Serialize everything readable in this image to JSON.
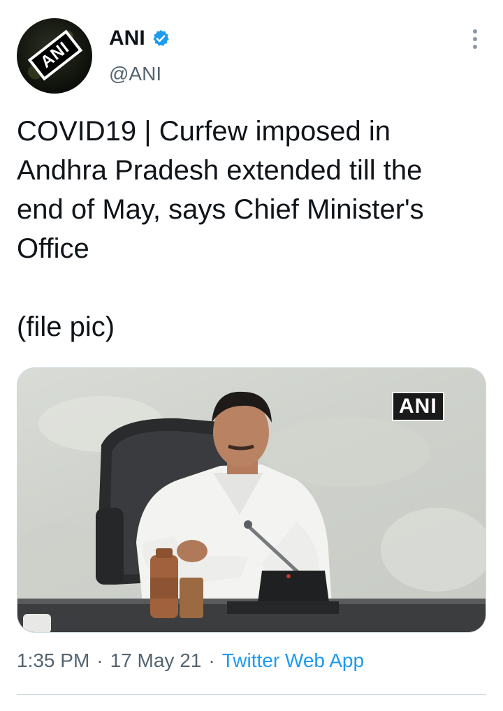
{
  "author": {
    "name": "ANI",
    "handle": "@ANI",
    "avatar_text": "ANI",
    "verified": true,
    "verified_icon": "verified-badge-icon"
  },
  "tweet": {
    "text": "COVID19 | Curfew imposed in\nAndhra Pradesh extended till the\nend of May, says Chief Minister's\nOffice\n\n(file pic)",
    "media": {
      "watermark": "ANI"
    }
  },
  "meta": {
    "time": "1:35 PM",
    "separator": "·",
    "date": "17 May 21",
    "source": "Twitter Web App"
  },
  "colors": {
    "accent": "#1d9bf0",
    "secondary_text": "#536471",
    "primary_text": "#0f1419"
  },
  "icons": {
    "more": "more-vertical-icon"
  }
}
